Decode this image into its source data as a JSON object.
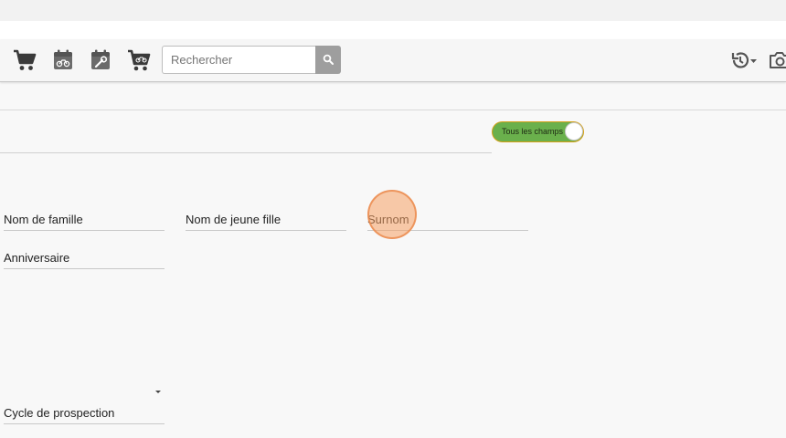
{
  "toolbar": {
    "icons": [
      "cart-icon",
      "calendar-motorcycle-icon",
      "calendar-wrench-icon",
      "cart-motorcycle-icon"
    ],
    "search": {
      "placeholder": "Rechercher",
      "value": ""
    },
    "right_icons": [
      "history-icon",
      "camera-icon"
    ]
  },
  "toggle": {
    "label": "Tous les champs",
    "state": "on",
    "color": "#6ab04c"
  },
  "fields": {
    "nom_famille": "Nom de famille",
    "nom_jeune_fille": "Nom de jeune fille",
    "surnom": "Surnom",
    "anniversaire": "Anniversaire",
    "cycle_prospection": "Cycle de prospection"
  }
}
